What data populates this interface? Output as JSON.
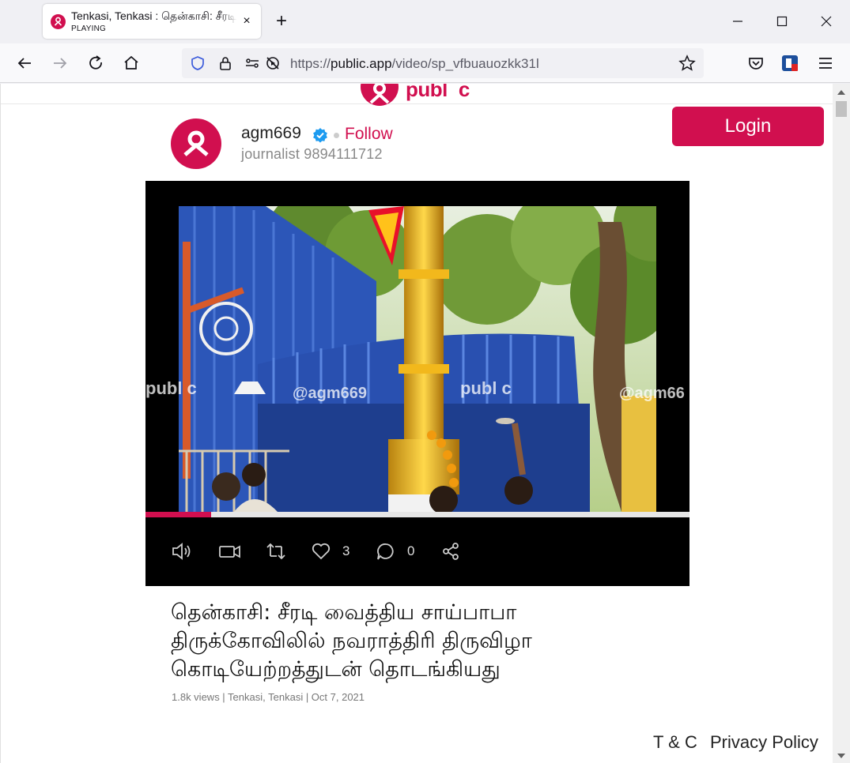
{
  "browser": {
    "tab": {
      "title": "Tenkasi, Tenkasi : தென்காசி: சீரடி வைத்திய சாய்பாபா",
      "status": "PLAYING",
      "close": "×"
    },
    "new_tab": "+",
    "url": {
      "prefix": "https://",
      "host": "public.app",
      "path": "/video/sp_vfbuauozkk31l"
    }
  },
  "site": {
    "brand": "publ",
    "brand_suffix": "c",
    "login_label": "Login"
  },
  "post": {
    "username": "agm669",
    "follow_label": "Follow",
    "role": "journalist 9894111712",
    "watermark_brand": "publ c",
    "watermark_handle": "@agm669",
    "watermark_handle_cut": "@agm66",
    "progress": 0.12,
    "likes": "3",
    "comments": "0",
    "headline": "தென்காசி: சீரடி வைத்திய சாய்பாபா திருக்கோவிலில் நவராத்திரி திருவிழா கொடியேற்றத்துடன் தொடங்கியது",
    "meta": "1.8k views | Tenkasi, Tenkasi | Oct 7, 2021"
  },
  "footer": {
    "terms": "T & C",
    "privacy": "Privacy Policy"
  },
  "colors": {
    "brand": "#d10f4f",
    "verified": "#1d9bf0"
  }
}
